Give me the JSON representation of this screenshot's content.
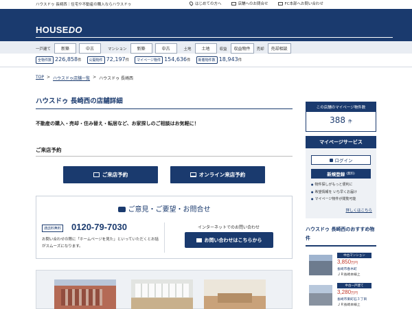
{
  "topbar": {
    "tagline": "ハウスドゥ 長崎西｜住宅や不動産の購入ならハウスドゥ",
    "links": [
      "はじめての方へ",
      "店舗へのお問合せ",
      "FC本部へお問い合わせ"
    ]
  },
  "header": {
    "logo_a": "HOUSE",
    "logo_b": "DO"
  },
  "catnav": {
    "groups": [
      {
        "label": "一戸建て",
        "items": [
          "新築",
          "中古"
        ]
      },
      {
        "label": "マンション",
        "items": [
          "新築",
          "中古"
        ]
      },
      {
        "label": "土地",
        "items": [
          "土地"
        ]
      },
      {
        "label": "収益",
        "items": [
          "収益物件"
        ]
      },
      {
        "label": "売却",
        "items": [
          "売却相談"
        ]
      }
    ]
  },
  "stats": [
    {
      "tag": "全物件数",
      "value": "226,858",
      "unit": "件"
    },
    {
      "tag": "公開物件",
      "value": "72,197",
      "unit": "件"
    },
    {
      "tag": "マイページ物件",
      "value": "154,636",
      "unit": "件"
    },
    {
      "tag": "新着物件数",
      "value": "18,943",
      "unit": "件"
    }
  ],
  "breadcrumb": {
    "top": "TOP",
    "list": "ハウスドゥ店舗一覧",
    "current": "ハウスドゥ 長崎西",
    "sep": ">"
  },
  "main": {
    "title": "ハウスドゥ 長崎西の店舗詳細",
    "intro": "不動産の購入・売却・住み替え・転居など、お家探しのご相談はお気軽に！",
    "reserve_heading": "ご来店予約",
    "visit_button": "ご来店予約",
    "online_button": "オンライン来店予約"
  },
  "inquiry": {
    "heading": "ご意見・ご要望・お問合せ",
    "tel_tag": "通話料無料",
    "tel": "0120-79-7030",
    "note": "お問い合わせの際に「ホームページを見た」といっていただくとお話がスムーズになります。",
    "net_label": "インターネットでのお問い合わせ",
    "net_button": "お問い合わせはこちらから"
  },
  "sidebar": {
    "count_header": "この店舗のマイページ物件数",
    "count_value": "388",
    "count_unit": "件",
    "mypage_header": "マイページサービス",
    "login": "ログイン",
    "register": "新規登録",
    "register_sub": "(無料)",
    "benefits": [
      "物件探しがもっと便利に",
      "希望情報を いち早くお届け",
      "マイページ物件が閲覧可能"
    ],
    "more": "詳しくはこちら",
    "recommend_heading": "ハウスドゥ 長崎西のおすすめ物件",
    "recommendations": [
      {
        "badge": "中古マンション",
        "price": "3,850",
        "unit": "万円",
        "addr": "長崎市春木町",
        "addr2": "ＪＲ長崎本線上"
      },
      {
        "badge": "中古一戸建て",
        "price": "3,280",
        "unit": "万円",
        "addr": "長崎市東町石３丁目",
        "addr2": "ＪＲ長崎本線上"
      }
    ]
  }
}
